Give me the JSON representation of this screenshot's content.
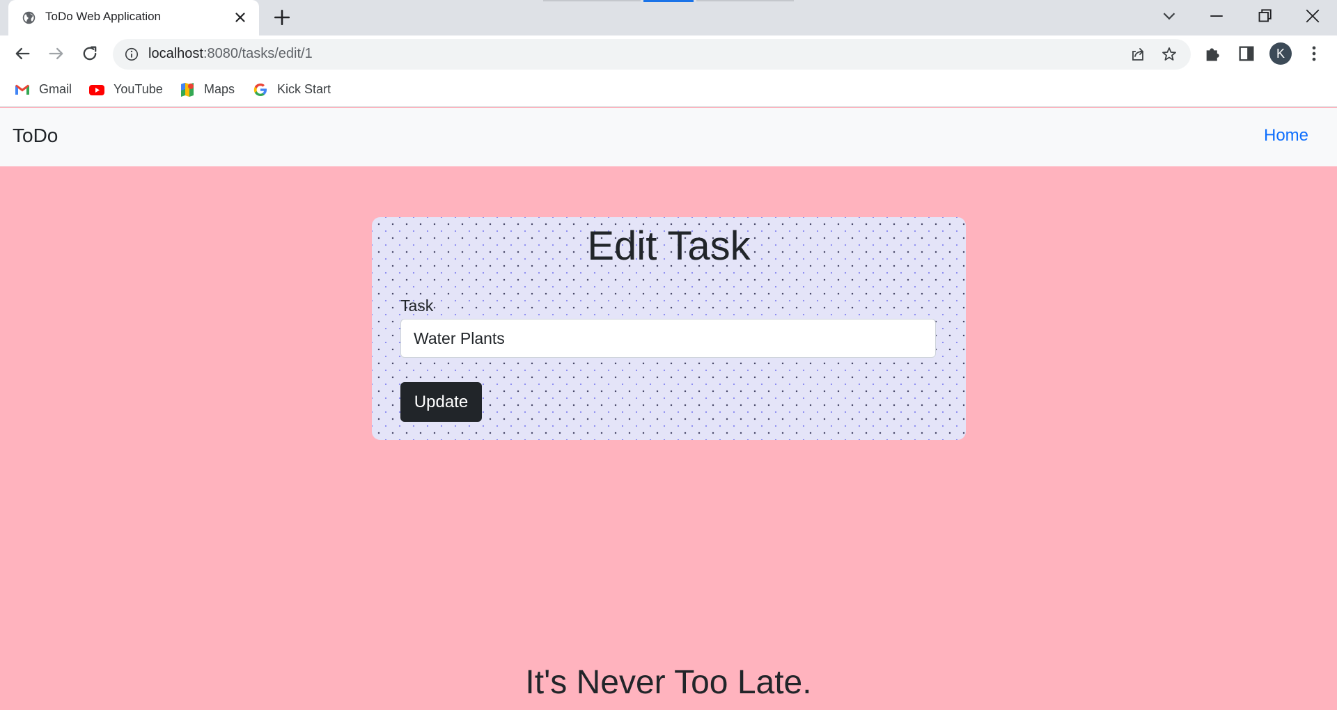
{
  "browser": {
    "tab_title": "ToDo Web Application",
    "url_host": "localhost",
    "url_path": ":8080/tasks/edit/1",
    "profile_initial": "K",
    "bookmarks": [
      {
        "label": "Gmail",
        "icon": "gmail-icon"
      },
      {
        "label": "YouTube",
        "icon": "youtube-icon"
      },
      {
        "label": "Maps",
        "icon": "maps-icon"
      },
      {
        "label": "Kick Start",
        "icon": "google-icon"
      }
    ]
  },
  "navbar": {
    "brand": "ToDo",
    "home_link": "Home"
  },
  "form": {
    "title": "Edit Task",
    "task_label": "Task",
    "task_value": "Water Plants",
    "submit_label": "Update"
  },
  "footer": {
    "tagline": "It's Never Too Late."
  },
  "colors": {
    "page_background": "#ffb3be",
    "card_background": "#e4e4f8",
    "button_background": "#212529",
    "link": "#0d6efd"
  }
}
